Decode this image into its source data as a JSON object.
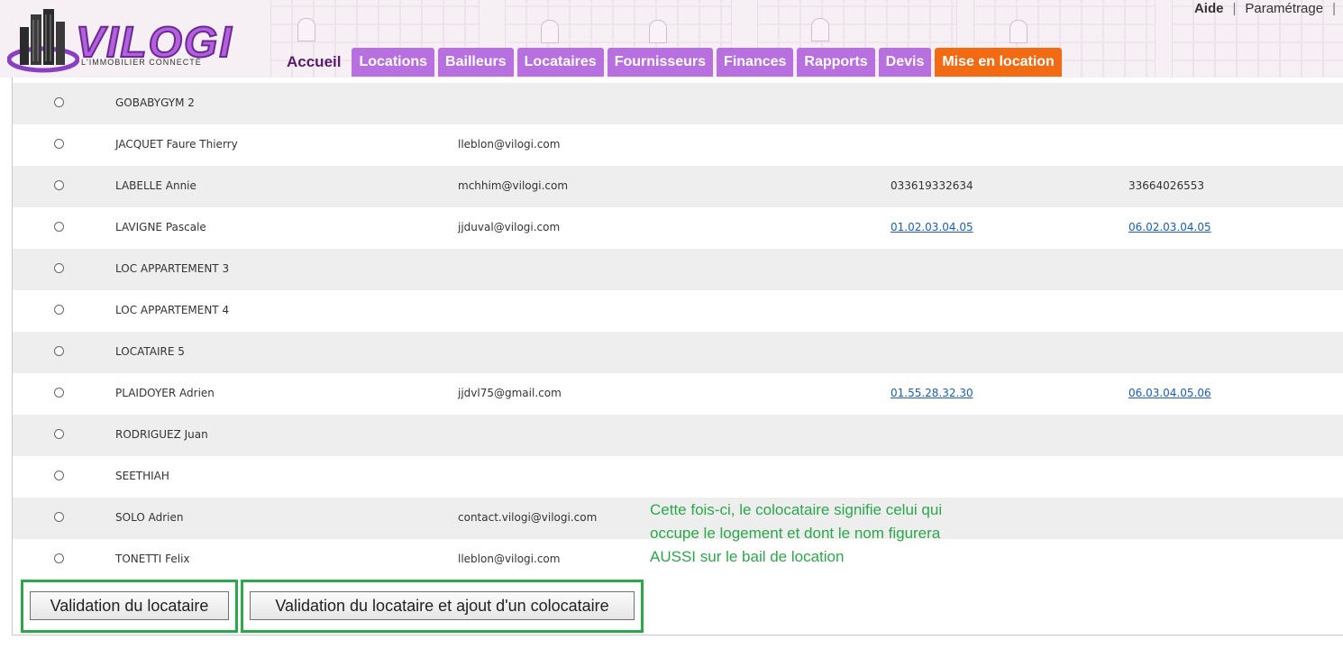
{
  "header": {
    "logo_text": "VILOGI",
    "logo_tagline": "L'IMMOBILIER CONNECTÉ",
    "top_links": [
      "Aide",
      "Paramétrage"
    ],
    "tabs": [
      {
        "label": "Accueil",
        "style": "home"
      },
      {
        "label": "Locations",
        "style": "purple"
      },
      {
        "label": "Bailleurs",
        "style": "purple"
      },
      {
        "label": "Locataires",
        "style": "purple"
      },
      {
        "label": "Fournisseurs",
        "style": "purple"
      },
      {
        "label": "Finances",
        "style": "purple"
      },
      {
        "label": "Rapports",
        "style": "purple"
      },
      {
        "label": "Devis",
        "style": "purple"
      },
      {
        "label": "Mise en location",
        "style": "orange"
      }
    ]
  },
  "rows": [
    {
      "name": "GOBABYGYM 2",
      "email": "",
      "tel1": "",
      "tel2": "",
      "tel_link": false
    },
    {
      "name": "JACQUET Faure Thierry",
      "email": "lleblon@vilogi.com",
      "tel1": "",
      "tel2": "",
      "tel_link": false
    },
    {
      "name": "LABELLE Annie",
      "email": "mchhim@vilogi.com",
      "tel1": "033619332634",
      "tel2": "33664026553",
      "tel_link": false
    },
    {
      "name": "LAVIGNE Pascale",
      "email": "jjduval@vilogi.com",
      "tel1": "01.02.03.04.05",
      "tel2": "06.02.03.04.05",
      "tel_link": true
    },
    {
      "name": "LOC APPARTEMENT 3",
      "email": "",
      "tel1": "",
      "tel2": "",
      "tel_link": false
    },
    {
      "name": "LOC APPARTEMENT 4",
      "email": "",
      "tel1": "",
      "tel2": "",
      "tel_link": false
    },
    {
      "name": "LOCATAIRE 5",
      "email": "",
      "tel1": "",
      "tel2": "",
      "tel_link": false
    },
    {
      "name": "PLAIDOYER Adrien",
      "email": "jjdvl75@gmail.com",
      "tel1": "01.55.28.32.30",
      "tel2": "06.03.04.05.06",
      "tel_link": true
    },
    {
      "name": "RODRIGUEZ Juan",
      "email": "",
      "tel1": "",
      "tel2": "",
      "tel_link": false
    },
    {
      "name": "SEETHIAH",
      "email": "",
      "tel1": "",
      "tel2": "",
      "tel_link": false
    },
    {
      "name": "SOLO Adrien",
      "email": "contact.vilogi@vilogi.com",
      "tel1": "",
      "tel2": "",
      "tel_link": false
    },
    {
      "name": "TONETTI Felix",
      "email": "lleblon@vilogi.com",
      "tel1": "",
      "tel2": "",
      "tel_link": false
    }
  ],
  "actions": {
    "validate_label": "Validation du locataire",
    "validate_add_label": "Validation du locataire et ajout d'un colocataire"
  },
  "annotation": {
    "text": "Cette fois-ci, le colocataire signifie celui qui occupe le logement et dont le nom figurera AUSSI sur le bail de location",
    "color": "#2aa84a"
  },
  "colors": {
    "tab_purple": "#b86fe0",
    "tab_orange": "#f26a12",
    "link": "#1a5fb4",
    "row_alt": "#eeeeee"
  }
}
